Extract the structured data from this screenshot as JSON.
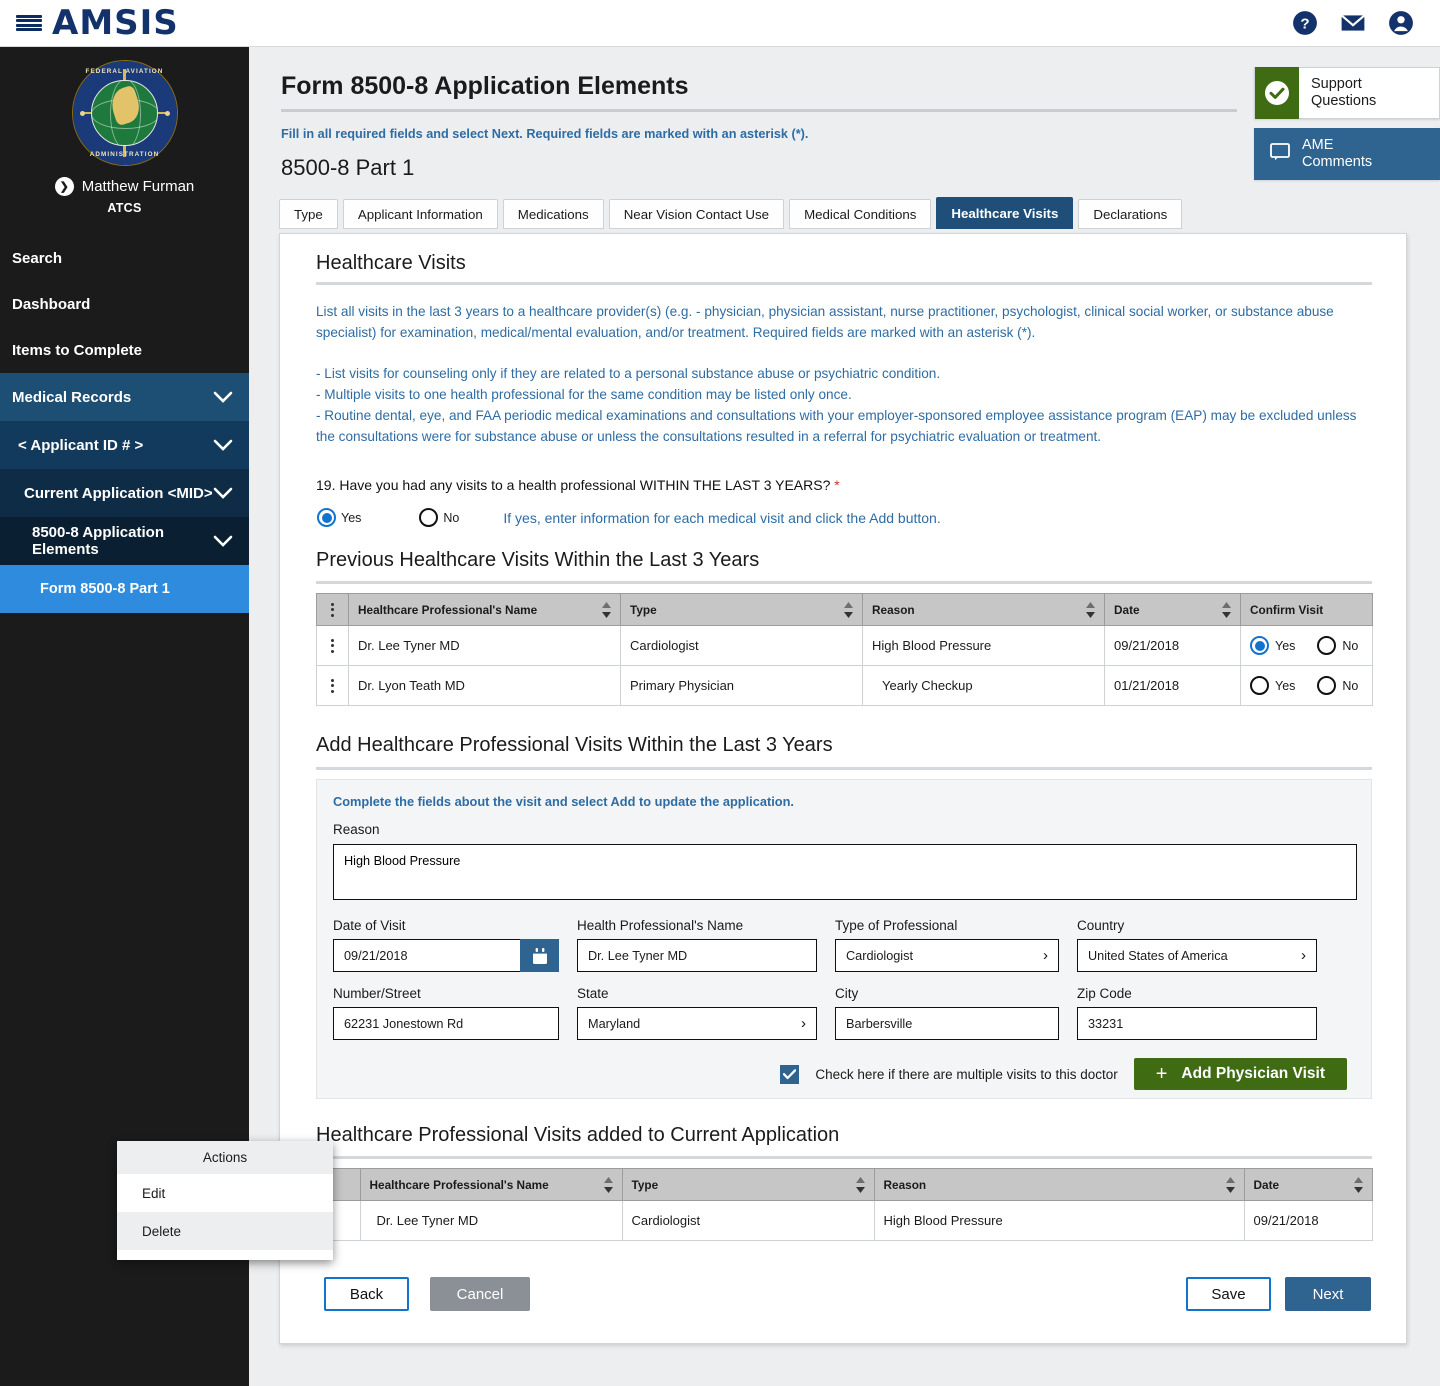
{
  "app": {
    "brand": "AMSIS",
    "menu_icon": "hamburger-icon",
    "header_icons": [
      "help-icon",
      "mail-icon",
      "account-icon"
    ]
  },
  "sidebar": {
    "seal_top": "FEDERAL AVIATION",
    "seal_bottom": "ADMINISTRATION",
    "user_name": "Matthew Furman",
    "user_role": "ATCS",
    "items": [
      {
        "label": "Search",
        "level": "plain",
        "expandable": false
      },
      {
        "label": "Dashboard",
        "level": "plain",
        "expandable": false
      },
      {
        "label": "Items to Complete",
        "level": "plain",
        "expandable": false
      },
      {
        "label": "Medical Records",
        "level": "lvl1",
        "expandable": true
      },
      {
        "label": "< Applicant ID # >",
        "level": "lvl2",
        "expandable": true
      },
      {
        "label": "Current Application <MID>",
        "level": "lvl3",
        "expandable": true
      },
      {
        "label": "8500-8 Application Elements",
        "level": "lvl4",
        "expandable": true
      },
      {
        "label": "Form 8500-8 Part 1",
        "level": "lvl5",
        "expandable": false,
        "selected": true
      }
    ]
  },
  "header": {
    "page_title": "Form 8500-8 Application Elements",
    "instruction": "Fill in all required fields and select Next. Required fields are marked with an asterisk (*).",
    "subtitle": "8500-8 Part 1",
    "support_label": "Support\nQuestions",
    "support_label_line1": "Support",
    "support_label_line2": "Questions",
    "ame_label_line1": "AME",
    "ame_label_line2": "Comments"
  },
  "tabs": [
    {
      "label": "Type",
      "active": false
    },
    {
      "label": "Applicant Information",
      "active": false
    },
    {
      "label": "Medications",
      "active": false
    },
    {
      "label": "Near Vision Contact Use",
      "active": false
    },
    {
      "label": "Medical Conditions",
      "active": false
    },
    {
      "label": "Healthcare Visits",
      "active": true
    },
    {
      "label": "Declarations",
      "active": false
    }
  ],
  "content": {
    "section_title": "Healthcare Visits",
    "intro": "List all visits in the last 3 years to a healthcare provider(s) (e.g. - physician, physician assistant, nurse practitioner, psychologist, clinical social worker, or substance abuse specialist) for examination, medical/mental evaluation, and/or treatment. Required fields are marked with an asterisk (*).",
    "bullets": [
      "- List visits for counseling only if they are related to a personal substance abuse or psychiatric condition.",
      "- Multiple visits to one health professional for the same condition may be listed only once.",
      "- Routine dental, eye, and FAA periodic medical examinations and consultations with your employer-sponsored employee assistance program (EAP) may be excluded unless the consultations were for substance abuse or unless the consultations resulted in a referral for psychiatric evaluation or treatment."
    ],
    "question": {
      "number": "19.",
      "text": "Have you had any visits to a health professional WITHIN THE LAST 3 YEARS?",
      "required_marker": "*",
      "yes_label": "Yes",
      "no_label": "No",
      "selected": "Yes",
      "helper": "If yes, enter information for each medical visit and click the Add button."
    }
  },
  "previous_visits": {
    "title": "Previous Healthcare Visits Within the Last 3 Years",
    "columns": [
      "Healthcare Professional's Name",
      "Type",
      "Reason",
      "Date",
      "Confirm Visit"
    ],
    "yes_label": "Yes",
    "no_label": "No",
    "rows": [
      {
        "name": "Dr. Lee Tyner MD",
        "type": "Cardiologist",
        "reason": "High Blood Pressure",
        "date": "09/21/2018",
        "confirm": "Yes"
      },
      {
        "name": "Dr. Lyon Teath MD",
        "type": "Primary Physician",
        "reason": "Yearly Checkup",
        "date": "01/21/2018",
        "confirm": ""
      }
    ]
  },
  "add_visit": {
    "title": "Add Healthcare Professional Visits Within the Last 3 Years",
    "hint": "Complete the fields about the visit and select Add to update the application.",
    "reason_label": "Reason",
    "reason_value": "High Blood Pressure",
    "fields": [
      {
        "label": "Date of Visit",
        "value": "09/21/2018",
        "kind": "date"
      },
      {
        "label": "Health Professional's Name",
        "value": "Dr. Lee Tyner MD",
        "kind": "text"
      },
      {
        "label": "Type of Professional",
        "value": "Cardiologist",
        "kind": "select"
      },
      {
        "label": "Country",
        "value": "United States of America",
        "kind": "select"
      },
      {
        "label": "Number/Street",
        "value": "62231 Jonestown Rd",
        "kind": "text"
      },
      {
        "label": "State",
        "value": "Maryland",
        "kind": "select"
      },
      {
        "label": "City",
        "value": "Barbersville",
        "kind": "text"
      },
      {
        "label": "Zip Code",
        "value": "33231",
        "kind": "text"
      }
    ],
    "multi_visit_label": "Check here if there are multiple visits to this doctor",
    "multi_visit_checked": true,
    "add_button": "Add Physician Visit"
  },
  "added_visits": {
    "title": "Healthcare Professional Visits added to Current Application",
    "columns": [
      "Healthcare Professional's Name",
      "Type",
      "Reason",
      "Date"
    ],
    "rows": [
      {
        "name": "Dr. Lee Tyner MD",
        "type": "Cardiologist",
        "reason": "High Blood Pressure",
        "date": "09/21/2018"
      }
    ]
  },
  "context_menu": {
    "header": "Actions",
    "items": [
      {
        "label": "Edit",
        "highlighted": false
      },
      {
        "label": "Delete",
        "highlighted": true
      }
    ]
  },
  "footer": {
    "back": "Back",
    "cancel": "Cancel",
    "save": "Save",
    "next": "Next"
  },
  "colors": {
    "brand_navy": "#13316b",
    "accent_blue": "#2e6ca4",
    "active_tab": "#1f4e79",
    "green": "#3f6b13",
    "sidebar_selected": "#2e8bde",
    "required_red": "#d0342c"
  }
}
